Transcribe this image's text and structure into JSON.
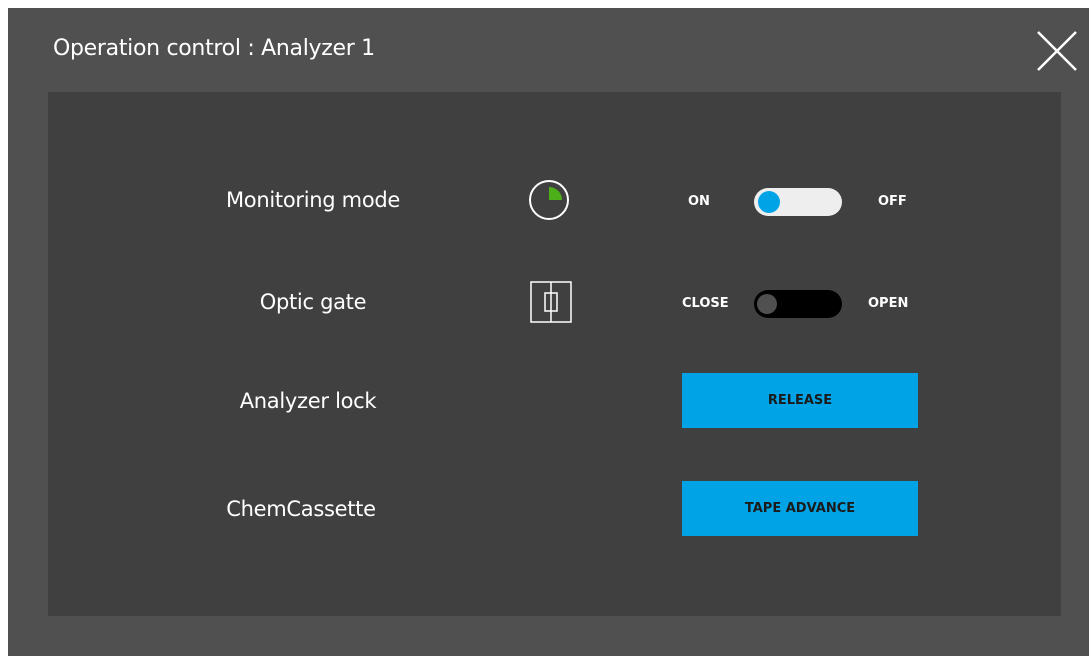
{
  "dialog": {
    "title": "Operation control : Analyzer 1",
    "close_icon": "close-icon"
  },
  "rows": {
    "monitoring": {
      "label": "Monitoring mode",
      "icon": "monitoring-pie-icon",
      "on_label": "ON",
      "off_label": "OFF",
      "state": "on"
    },
    "optic_gate": {
      "label": "Optic gate",
      "icon": "optic-gate-icon",
      "close_label": "CLOSE",
      "open_label": "OPEN",
      "state": "close"
    },
    "analyzer_lock": {
      "label": "Analyzer lock",
      "button_label": "RELEASE"
    },
    "chemcassette": {
      "label": "ChemCassette",
      "button_label": "TAPE ADVANCE"
    }
  },
  "colors": {
    "accent": "#00a3e6",
    "pie_fill": "#4caf1a",
    "dialog_bg": "#505050",
    "panel_bg": "#404040"
  }
}
